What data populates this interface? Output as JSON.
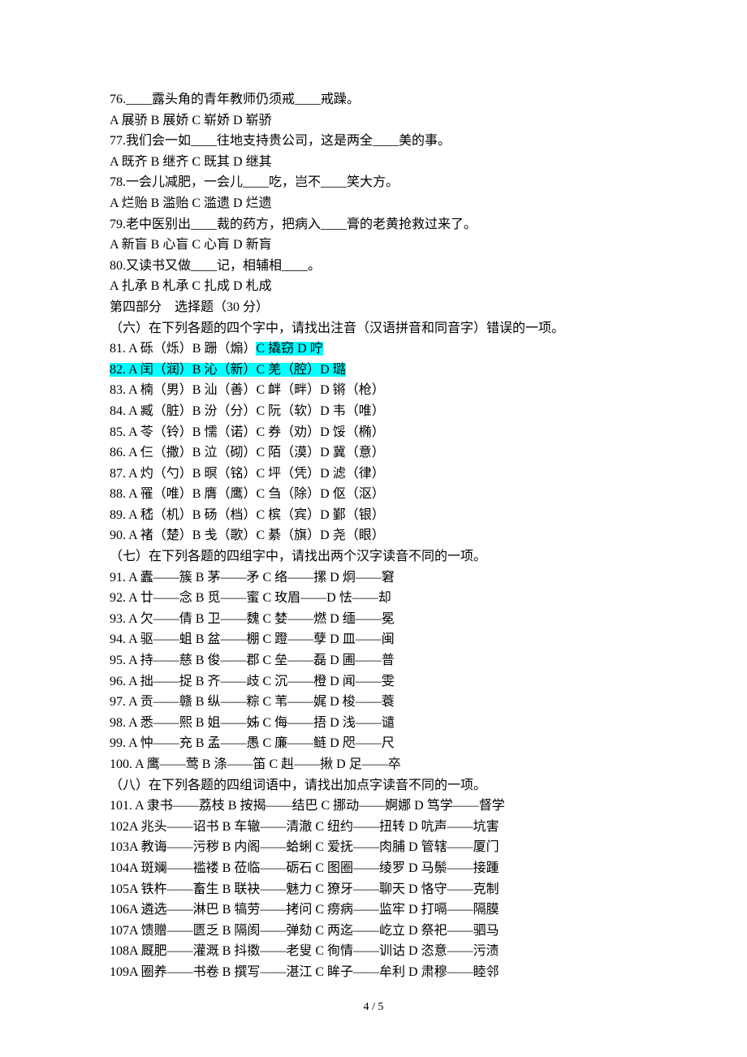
{
  "lines": [
    {
      "parts": [
        {
          "text": "76.____露头角的青年教师仍须戒____戒躁。"
        }
      ]
    },
    {
      "parts": [
        {
          "text": "A 展骄 B 展娇 C 崭娇 D 崭骄"
        }
      ]
    },
    {
      "parts": [
        {
          "text": "77.我们会一如____往地支持贵公司，这是两全____美的事。"
        }
      ]
    },
    {
      "parts": [
        {
          "text": "A 既齐 B 继齐 C 既其 D 继其"
        }
      ]
    },
    {
      "parts": [
        {
          "text": "78.一会儿减肥，一会儿____吃，岂不____笑大方。"
        }
      ]
    },
    {
      "parts": [
        {
          "text": "A 烂贻 B 滥贻 C 滥遗 D 烂遗"
        }
      ]
    },
    {
      "parts": [
        {
          "text": "79.老中医别出____裁的药方，把病入____膏的老黄抢救过来了。"
        }
      ]
    },
    {
      "parts": [
        {
          "text": "A 新盲 B 心盲 C 心肓 D 新肓"
        }
      ]
    },
    {
      "parts": [
        {
          "text": "80.又读书又做____记，相辅相____。"
        }
      ]
    },
    {
      "parts": [
        {
          "text": "A 扎承 B 札承 C 扎成 D 札成"
        }
      ]
    },
    {
      "parts": [
        {
          "text": " "
        }
      ]
    },
    {
      "parts": [
        {
          "text": "第四部分　选择题（30 分）"
        }
      ]
    },
    {
      "parts": [
        {
          "text": "（六）在下列各题的四个字中，请找出注音（汉语拼音和同音字）错误的一项。"
        }
      ]
    },
    {
      "parts": [
        {
          "text": "81. A 砾（烁）B 跚（煽）"
        },
        {
          "text": "C 撬窃 D 咛",
          "hl": true
        }
      ]
    },
    {
      "parts": [
        {
          "text": "82. A 闰（润）",
          "hl": true
        },
        {
          "text": "B 沁（新）",
          "hl": true
        },
        {
          "text": "C 羌（腔）",
          "hl": true
        },
        {
          "text": "D 璐",
          "hl": true
        }
      ]
    },
    {
      "parts": [
        {
          "text": "83. A 楠（男）B 汕（善）C 衅（畔）D 锵（枪）"
        }
      ]
    },
    {
      "parts": [
        {
          "text": "84. A 臧（脏）B 汾（分）C 阮（软）D 韦（唯）"
        }
      ]
    },
    {
      "parts": [
        {
          "text": "85. A 苓（铃）B 懦（诺）C 券（劝）D 馁（椭）"
        }
      ]
    },
    {
      "parts": [
        {
          "text": "86. A 仨（撒）B 泣（砌）C 陌（漠）D 冀（意）"
        }
      ]
    },
    {
      "parts": [
        {
          "text": "87. A 灼（勺）B 暝（铭）C 坪（凭）D 滤（律）"
        }
      ]
    },
    {
      "parts": [
        {
          "text": "88. A 罹（唯）B 膺（鹰）C 刍（除）D 伛（沤）"
        }
      ]
    },
    {
      "parts": [
        {
          "text": "89. A 嵇（机）B 砀（档）C 槟（宾）D 鄞（银）"
        }
      ]
    },
    {
      "parts": [
        {
          "text": "90. A 褚（楚）B 戋（歌）C 綦（旗）D 尧（眼）"
        }
      ]
    },
    {
      "parts": [
        {
          "text": "（七）在下列各题的四组字中，请找出两个汉字读音不同的一项。"
        }
      ]
    },
    {
      "parts": [
        {
          "text": "91. A 蠹——簇 B 茅——矛 C 络——摞 D 炯——窘"
        }
      ]
    },
    {
      "parts": [
        {
          "text": "92. A 廿——念 B 觅——蜜 C 玫眉——D 怯——却"
        }
      ]
    },
    {
      "parts": [
        {
          "text": "93. A 欠——倩 B 卫——魏 C 婪——燃 D 缅——冕"
        }
      ]
    },
    {
      "parts": [
        {
          "text": "94. A 驱——蛆 B 盆——棚 C 蹬——孽 D 皿——闽"
        }
      ]
    },
    {
      "parts": [
        {
          "text": "95. A 持——慈 B 俊——郡 C 垒——磊 D 圃——普"
        }
      ]
    },
    {
      "parts": [
        {
          "text": "96. A 拙——捉 B 齐——歧 C 沉——橙 D 闻——雯"
        }
      ]
    },
    {
      "parts": [
        {
          "text": "97. A 贡——赣 B 纵——粽 C 苇——娓 D 梭——蓑"
        }
      ]
    },
    {
      "parts": [
        {
          "text": "98. A 悉——熙 B 姐——姊 C 侮——捂 D 浅——谴"
        }
      ]
    },
    {
      "parts": [
        {
          "text": "99. A 忡——充 B 孟——愚 C 廉——鲢 D 咫——尺"
        }
      ]
    },
    {
      "parts": [
        {
          "text": "100. A 鹰——莺 B 涤——笛 C 赳——揪 D 足——卒"
        }
      ]
    },
    {
      "parts": [
        {
          "text": "（八）在下列各题的四组词语中，请找出加点字读音不同的一项。"
        }
      ]
    },
    {
      "parts": [
        {
          "text": "101. A 隶书——荔枝 B 按揭——结巴 C 挪动——婀娜 D 笃学——督学"
        }
      ]
    },
    {
      "parts": [
        {
          "text": "102A 兆头——诏书 B 车辙——清澈 C 纽约——扭转 D 吭声——坑害"
        }
      ]
    },
    {
      "parts": [
        {
          "text": "103A 教诲——污秽 B 内阁——蛤蜊 C 爱抚——肉脯 D 管辖——厦门"
        }
      ]
    },
    {
      "parts": [
        {
          "text": "104A 斑斓——褴褛 B 莅临——砺石 C 图圈——绫罗 D 马鬃——接踵"
        }
      ]
    },
    {
      "parts": [
        {
          "text": "105A 铁杵——畜生 B 联袂——魅力 C 獠牙——聊天 D 恪守——克制"
        }
      ]
    },
    {
      "parts": [
        {
          "text": "106A 遴选——淋巴 B 犒劳——拷问 C 痨病——监牢 D 打嗝——隔膜"
        }
      ]
    },
    {
      "parts": [
        {
          "text": "107A 馈赠——匮乏 B 隔阂——弹劾 C 两迄——屹立 D 祭祀——驷马"
        }
      ]
    },
    {
      "parts": [
        {
          "text": "108A 厩肥——灌溉 B 抖擞——老叟 C 徇情——训诂 D 恣意——污渍"
        }
      ]
    },
    {
      "parts": [
        {
          "text": "109A 圈养——书卷 B 撰写——湛江 C 眸子——牟利 D 肃穆——睦邻"
        }
      ]
    }
  ],
  "footer": "4 / 5"
}
